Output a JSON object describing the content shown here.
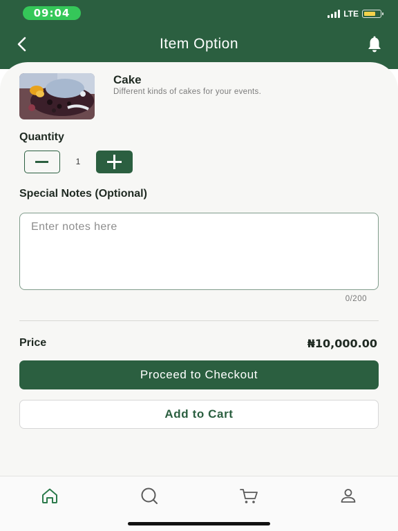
{
  "status_bar": {
    "time": "09:04",
    "network": "LTE"
  },
  "header": {
    "title": "Item Option"
  },
  "item": {
    "name": "Cake",
    "description": "Different kinds of cakes for your events."
  },
  "quantity": {
    "label": "Quantity",
    "value": "1"
  },
  "notes": {
    "label": "Special Notes (Optional)",
    "placeholder": "Enter notes here",
    "char_count": "0/200"
  },
  "price": {
    "label": "Price",
    "value": "₦10,000.00"
  },
  "actions": {
    "checkout_label": "Proceed to Checkout",
    "add_to_cart_label": "Add to Cart"
  },
  "bottom_nav": {
    "items": [
      "home-icon",
      "search-icon",
      "cart-icon",
      "profile-icon"
    ],
    "active": "home-icon"
  },
  "colors": {
    "brand_green": "#2b5f40",
    "time_pill": "#35c759",
    "background": "#f7f7f5"
  }
}
